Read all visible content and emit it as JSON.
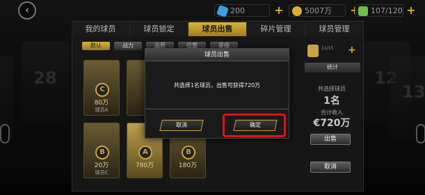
{
  "background": {
    "locker_numbers": [
      "28",
      "12",
      "13",
      "12",
      "13"
    ]
  },
  "topbar": {
    "back_icon": "back-arrow-icon",
    "resources": [
      {
        "name": "energy",
        "value": "200",
        "icon": "energy-icon",
        "color": "#3aa0e6"
      },
      {
        "name": "coins",
        "value": "5007万",
        "icon": "coin-icon",
        "color": "#d7b030"
      },
      {
        "name": "squad",
        "value": "107/120",
        "icon": "player-icon",
        "color": "#6fbf4a"
      }
    ]
  },
  "tabs": [
    {
      "label": "我的球员",
      "active": false
    },
    {
      "label": "球员锁定",
      "active": false
    },
    {
      "label": "球员出售",
      "active": true
    },
    {
      "label": "碎片管理",
      "active": false
    },
    {
      "label": "球员管理",
      "active": false
    }
  ],
  "filters": [
    {
      "label": "默认",
      "active": true
    },
    {
      "label": "战力",
      "active": false
    },
    {
      "label": "品质",
      "active": false
    },
    {
      "label": "位置",
      "active": false
    },
    {
      "label": "星级",
      "active": false
    }
  ],
  "cards": [
    {
      "value": "80万",
      "name": "球员A"
    },
    {
      "value": "",
      "name": ""
    },
    {
      "value": "20万",
      "name": "球员C"
    },
    {
      "value": "780万",
      "name": ""
    },
    {
      "value": "180万",
      "name": ""
    }
  ],
  "sidebar": {
    "stats_button": "统计",
    "selected_label": "共选择球员",
    "selected_count": "1名",
    "income_label": "合计收入",
    "income_value": "€720万",
    "sell_button": "出售",
    "cancel_button": "取消",
    "capacity_label": "11/15"
  },
  "modal": {
    "title": "球员出售",
    "message": "共选择1名球员，出售可获得720万",
    "cancel_label": "取消",
    "confirm_label": "确定"
  },
  "colors": {
    "accent_gold": "#c9a545",
    "highlight_red": "#e11212"
  }
}
